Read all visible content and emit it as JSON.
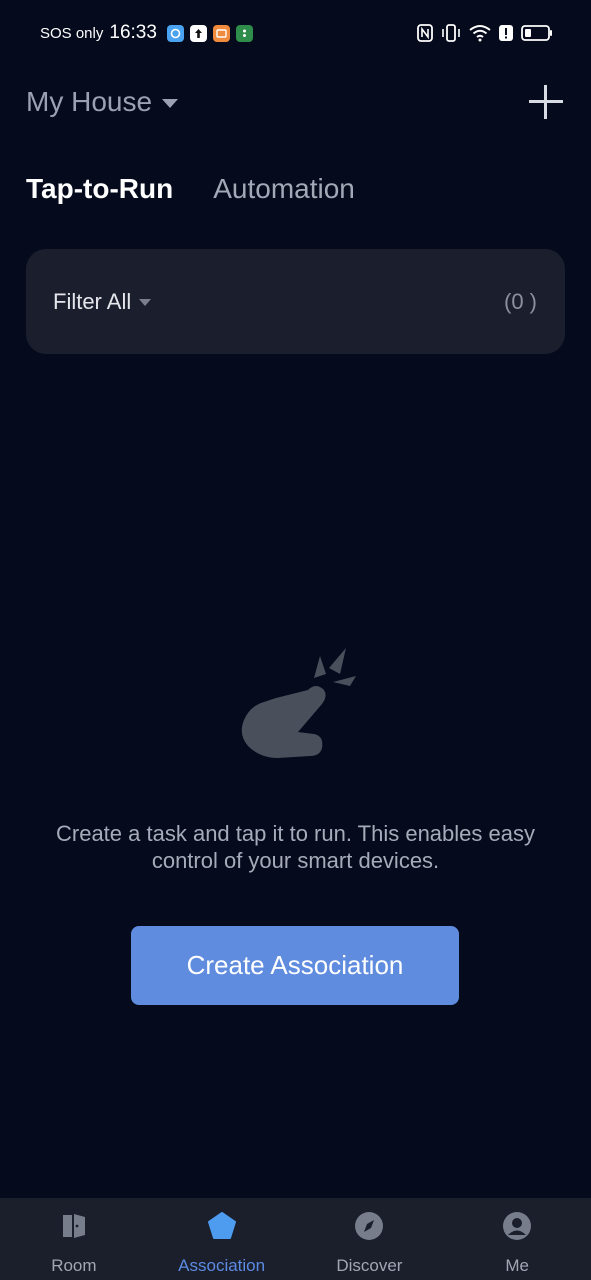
{
  "status_bar": {
    "carrier": "SOS only",
    "time": "16:33"
  },
  "header": {
    "home_name": "My House"
  },
  "tabs": [
    {
      "label": "Tap-to-Run",
      "active": true
    },
    {
      "label": "Automation",
      "active": false
    }
  ],
  "filter": {
    "label": "Filter All",
    "count": "(0 )"
  },
  "empty_state": {
    "message": "Create a task and tap it to run. This enables easy control of your smart devices.",
    "button_label": "Create Association"
  },
  "bottom_nav": [
    {
      "label": "Room",
      "icon": "door-icon",
      "active": false
    },
    {
      "label": "Association",
      "icon": "pentagon-icon",
      "active": true
    },
    {
      "label": "Discover",
      "icon": "compass-icon",
      "active": false
    },
    {
      "label": "Me",
      "icon": "profile-icon",
      "active": false
    }
  ],
  "colors": {
    "background": "#050a1c",
    "card": "#1b1f2d",
    "accent": "#5f8cde",
    "nav_active": "#5b8be3",
    "nav_bar": "#1b1e2b"
  }
}
